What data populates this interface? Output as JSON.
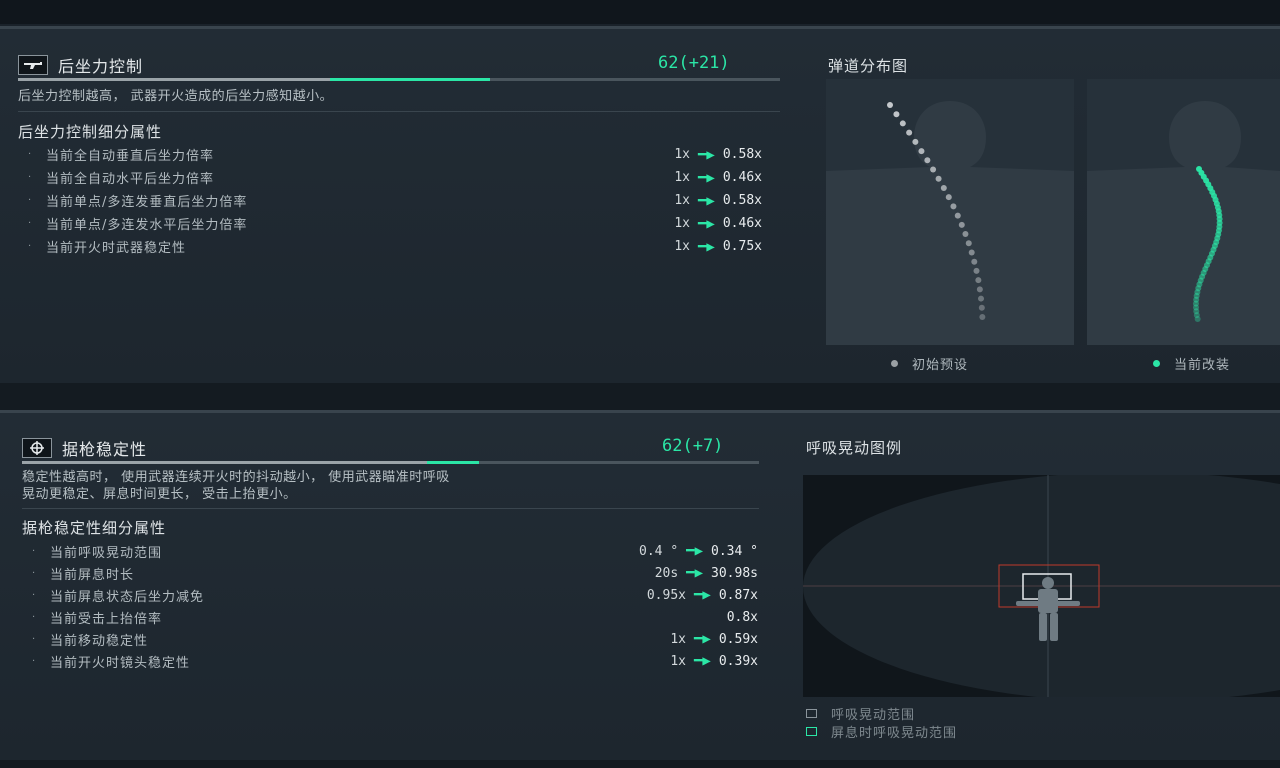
{
  "recoil": {
    "title": "后坐力控制",
    "icon": "rifle-icon",
    "score": "62(+21)",
    "base_fraction": 0.41,
    "added_fraction": 0.21,
    "description": "后坐力控制越高， 武器开火造成的后坐力感知越小。",
    "sub_title": "后坐力控制细分属性",
    "rows": [
      {
        "label": "当前全自动垂直后坐力倍率",
        "old": "1x",
        "new": "0.58x"
      },
      {
        "label": "当前全自动水平后坐力倍率",
        "old": "1x",
        "new": "0.46x"
      },
      {
        "label": "当前单点/多连发垂直后坐力倍率",
        "old": "1x",
        "new": "0.58x"
      },
      {
        "label": "当前单点/多连发水平后坐力倍率",
        "old": "1x",
        "new": "0.46x"
      },
      {
        "label": "当前开火时武器稳定性",
        "old": "1x",
        "new": "0.75x"
      }
    ],
    "chart_title": "弹道分布图",
    "legend": [
      {
        "label": "初始预设",
        "color": "#9aa0a4"
      },
      {
        "label": "当前改装",
        "color": "#2be6a6"
      }
    ]
  },
  "stability": {
    "title": "据枪稳定性",
    "icon": "crosshair-icon",
    "score": "62(+7)",
    "base_fraction": 0.55,
    "added_fraction": 0.07,
    "description_line1": "稳定性越高时， 使用武器连续开火时的抖动越小， 使用武器瞄准时呼吸",
    "description_line2": "晃动更稳定、屏息时间更长， 受击上抬更小。",
    "sub_title": "据枪稳定性细分属性",
    "rows": [
      {
        "label": "当前呼吸晃动范围",
        "old": "0.4 °",
        "new": "0.34 °"
      },
      {
        "label": "当前屏息时长",
        "old": "20s",
        "new": "30.98s"
      },
      {
        "label": "当前屏息状态后坐力减免",
        "old": "0.95x",
        "new": "0.87x"
      },
      {
        "label": "当前受击上抬倍率",
        "old": "",
        "new": "0.8x"
      },
      {
        "label": "当前移动稳定性",
        "old": "1x",
        "new": "0.59x"
      },
      {
        "label": "当前开火时镜头稳定性",
        "old": "1x",
        "new": "0.39x"
      }
    ],
    "chart_title": "呼吸晃动图例",
    "legend": [
      {
        "label": "呼吸晃动范围",
        "color": "#8a949b"
      },
      {
        "label": "屏息时呼吸晃动范围",
        "color": "#2be6a6"
      }
    ]
  },
  "colors": {
    "accent": "#2be6a6",
    "sway_range": "#c0392b"
  }
}
